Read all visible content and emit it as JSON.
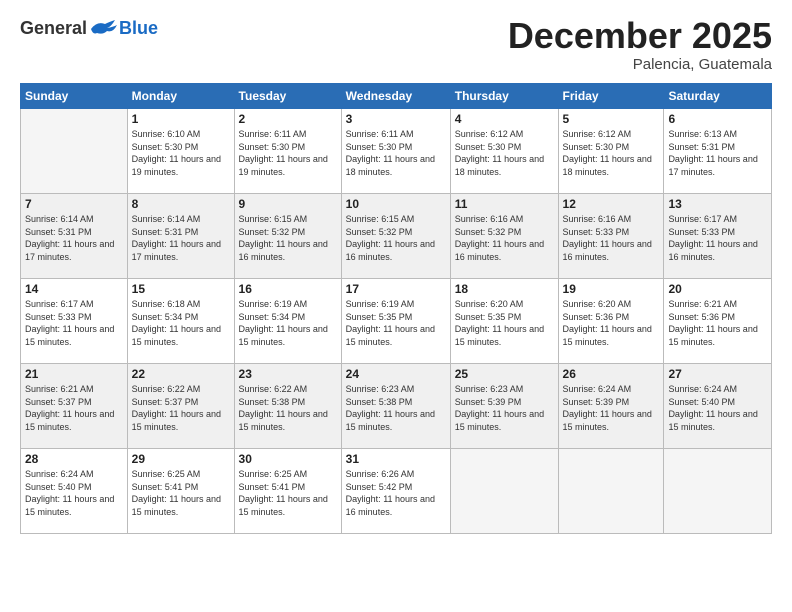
{
  "header": {
    "logo_general": "General",
    "logo_blue": "Blue",
    "month": "December 2025",
    "location": "Palencia, Guatemala"
  },
  "weekdays": [
    "Sunday",
    "Monday",
    "Tuesday",
    "Wednesday",
    "Thursday",
    "Friday",
    "Saturday"
  ],
  "weeks": [
    [
      {
        "day": "",
        "empty": true
      },
      {
        "day": "1",
        "sunrise": "6:10 AM",
        "sunset": "5:30 PM",
        "daylight": "11 hours and 19 minutes."
      },
      {
        "day": "2",
        "sunrise": "6:11 AM",
        "sunset": "5:30 PM",
        "daylight": "11 hours and 19 minutes."
      },
      {
        "day": "3",
        "sunrise": "6:11 AM",
        "sunset": "5:30 PM",
        "daylight": "11 hours and 18 minutes."
      },
      {
        "day": "4",
        "sunrise": "6:12 AM",
        "sunset": "5:30 PM",
        "daylight": "11 hours and 18 minutes."
      },
      {
        "day": "5",
        "sunrise": "6:12 AM",
        "sunset": "5:30 PM",
        "daylight": "11 hours and 18 minutes."
      },
      {
        "day": "6",
        "sunrise": "6:13 AM",
        "sunset": "5:31 PM",
        "daylight": "11 hours and 17 minutes."
      }
    ],
    [
      {
        "day": "7",
        "sunrise": "6:14 AM",
        "sunset": "5:31 PM",
        "daylight": "11 hours and 17 minutes."
      },
      {
        "day": "8",
        "sunrise": "6:14 AM",
        "sunset": "5:31 PM",
        "daylight": "11 hours and 17 minutes."
      },
      {
        "day": "9",
        "sunrise": "6:15 AM",
        "sunset": "5:32 PM",
        "daylight": "11 hours and 16 minutes."
      },
      {
        "day": "10",
        "sunrise": "6:15 AM",
        "sunset": "5:32 PM",
        "daylight": "11 hours and 16 minutes."
      },
      {
        "day": "11",
        "sunrise": "6:16 AM",
        "sunset": "5:32 PM",
        "daylight": "11 hours and 16 minutes."
      },
      {
        "day": "12",
        "sunrise": "6:16 AM",
        "sunset": "5:33 PM",
        "daylight": "11 hours and 16 minutes."
      },
      {
        "day": "13",
        "sunrise": "6:17 AM",
        "sunset": "5:33 PM",
        "daylight": "11 hours and 16 minutes."
      }
    ],
    [
      {
        "day": "14",
        "sunrise": "6:17 AM",
        "sunset": "5:33 PM",
        "daylight": "11 hours and 15 minutes."
      },
      {
        "day": "15",
        "sunrise": "6:18 AM",
        "sunset": "5:34 PM",
        "daylight": "11 hours and 15 minutes."
      },
      {
        "day": "16",
        "sunrise": "6:19 AM",
        "sunset": "5:34 PM",
        "daylight": "11 hours and 15 minutes."
      },
      {
        "day": "17",
        "sunrise": "6:19 AM",
        "sunset": "5:35 PM",
        "daylight": "11 hours and 15 minutes."
      },
      {
        "day": "18",
        "sunrise": "6:20 AM",
        "sunset": "5:35 PM",
        "daylight": "11 hours and 15 minutes."
      },
      {
        "day": "19",
        "sunrise": "6:20 AM",
        "sunset": "5:36 PM",
        "daylight": "11 hours and 15 minutes."
      },
      {
        "day": "20",
        "sunrise": "6:21 AM",
        "sunset": "5:36 PM",
        "daylight": "11 hours and 15 minutes."
      }
    ],
    [
      {
        "day": "21",
        "sunrise": "6:21 AM",
        "sunset": "5:37 PM",
        "daylight": "11 hours and 15 minutes."
      },
      {
        "day": "22",
        "sunrise": "6:22 AM",
        "sunset": "5:37 PM",
        "daylight": "11 hours and 15 minutes."
      },
      {
        "day": "23",
        "sunrise": "6:22 AM",
        "sunset": "5:38 PM",
        "daylight": "11 hours and 15 minutes."
      },
      {
        "day": "24",
        "sunrise": "6:23 AM",
        "sunset": "5:38 PM",
        "daylight": "11 hours and 15 minutes."
      },
      {
        "day": "25",
        "sunrise": "6:23 AM",
        "sunset": "5:39 PM",
        "daylight": "11 hours and 15 minutes."
      },
      {
        "day": "26",
        "sunrise": "6:24 AM",
        "sunset": "5:39 PM",
        "daylight": "11 hours and 15 minutes."
      },
      {
        "day": "27",
        "sunrise": "6:24 AM",
        "sunset": "5:40 PM",
        "daylight": "11 hours and 15 minutes."
      }
    ],
    [
      {
        "day": "28",
        "sunrise": "6:24 AM",
        "sunset": "5:40 PM",
        "daylight": "11 hours and 15 minutes."
      },
      {
        "day": "29",
        "sunrise": "6:25 AM",
        "sunset": "5:41 PM",
        "daylight": "11 hours and 15 minutes."
      },
      {
        "day": "30",
        "sunrise": "6:25 AM",
        "sunset": "5:41 PM",
        "daylight": "11 hours and 15 minutes."
      },
      {
        "day": "31",
        "sunrise": "6:26 AM",
        "sunset": "5:42 PM",
        "daylight": "11 hours and 16 minutes."
      },
      {
        "day": "",
        "empty": true
      },
      {
        "day": "",
        "empty": true
      },
      {
        "day": "",
        "empty": true
      }
    ]
  ]
}
